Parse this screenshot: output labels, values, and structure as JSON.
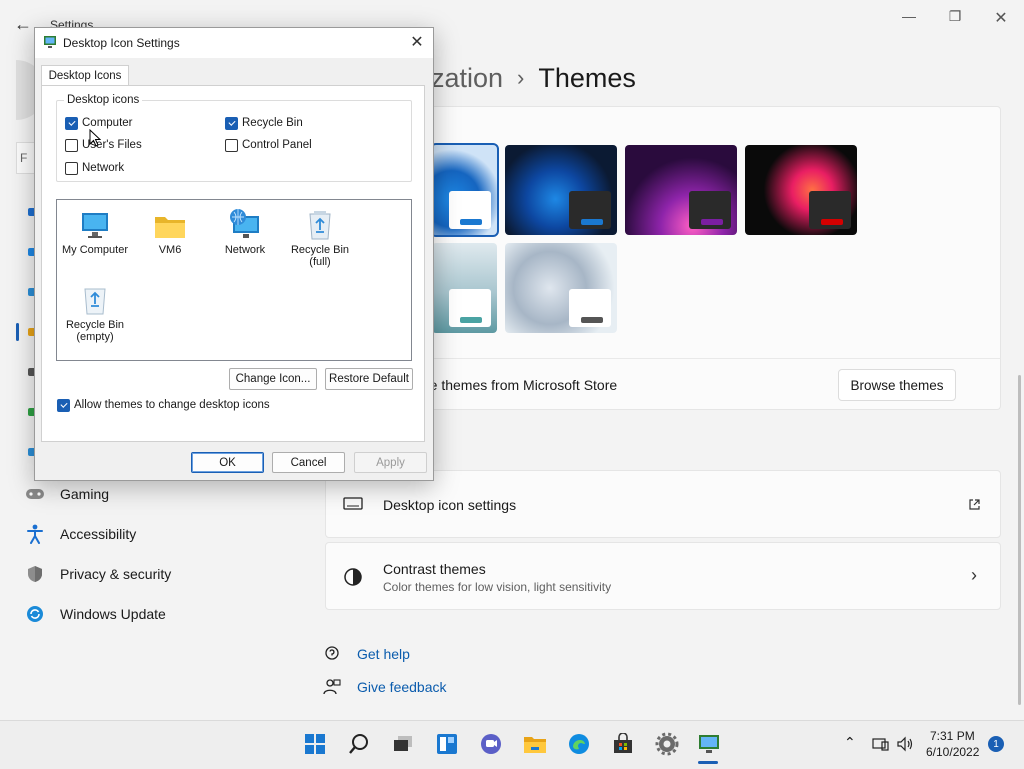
{
  "settings": {
    "app_title": "Settings",
    "breadcrumb_parent": "ization",
    "breadcrumb_current": "Themes",
    "nav": [
      {
        "label": "Gaming"
      },
      {
        "label": "Accessibility"
      },
      {
        "label": "Privacy & security"
      },
      {
        "label": "Windows Update"
      }
    ],
    "store_text": "re themes from Microsoft Store",
    "browse_themes": "Browse themes",
    "related": [
      {
        "title": "Desktop icon settings"
      },
      {
        "title": "Contrast themes",
        "subtitle": "Color themes for low vision, light sensitivity"
      }
    ],
    "get_help": "Get help",
    "give_feedback": "Give feedback",
    "search_stub": "F"
  },
  "dialog": {
    "title": "Desktop Icon Settings",
    "tab": "Desktop Icons",
    "group_label": "Desktop icons",
    "checkboxes": [
      {
        "label": "Computer",
        "checked": true
      },
      {
        "label": "Recycle Bin",
        "checked": true
      },
      {
        "label": "User's Files",
        "checked": false
      },
      {
        "label": "Control Panel",
        "checked": false
      },
      {
        "label": "Network",
        "checked": false
      }
    ],
    "icons": [
      {
        "label": "My Computer",
        "icon": "monitor-icon"
      },
      {
        "label": "VM6",
        "icon": "folder-icon"
      },
      {
        "label": "Network",
        "icon": "network-globe-icon"
      },
      {
        "label": "Recycle Bin (full)",
        "icon": "recycle-bin-full-icon"
      },
      {
        "label": "Recycle Bin (empty)",
        "icon": "recycle-bin-empty-icon"
      }
    ],
    "change_icon": "Change Icon...",
    "restore_default": "Restore Default",
    "allow_themes": "Allow themes to change desktop icons",
    "allow_themes_checked": true,
    "ok": "OK",
    "cancel": "Cancel",
    "apply": "Apply"
  },
  "taskbar": {
    "time": "7:31 PM",
    "date": "6/10/2022",
    "notification_count": "1"
  },
  "colors": {
    "accent": "#1a5fb4",
    "link": "#0b5cad"
  }
}
